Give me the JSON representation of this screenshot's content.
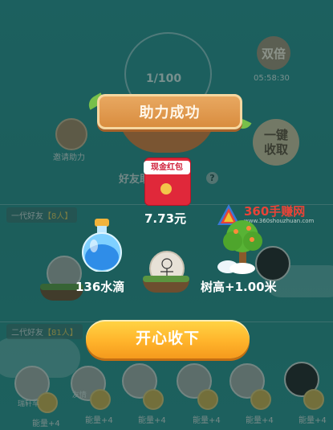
{
  "game": {
    "progress": "1/100",
    "double_label": "双倍",
    "timer": "05:58:30",
    "collect_label_1": "一键",
    "collect_label_2": "收取",
    "invite_label": "邀请助力",
    "friends_title": "好友助力",
    "help_icon": "?",
    "tier1_label": "一代好友",
    "tier1_count": "【8人】",
    "tier2_label": "二代好友",
    "tier2_count": "【81人】",
    "energy_items": [
      "能量+4",
      "能量+4",
      "能量+4",
      "能量+4",
      "能量+4",
      "能量+4",
      "能量+4"
    ],
    "bottom_name_1": "瑞轩车",
    "bottom_name_2": "友情"
  },
  "watermark": {
    "title": "360手赚网",
    "url": "www.360shouzhuan.com"
  },
  "modal": {
    "title": "助力成功",
    "redpack_label": "现金红包",
    "money": "7.73元",
    "water": "136水滴",
    "tree": "树高+1.00米",
    "confirm_label": "开心收下"
  },
  "colors": {
    "background": "#2e8d8a",
    "banner": "#e29b4f",
    "cta": "#ffb42b",
    "redpack": "#e0283a",
    "watermark_red": "#e94337"
  }
}
